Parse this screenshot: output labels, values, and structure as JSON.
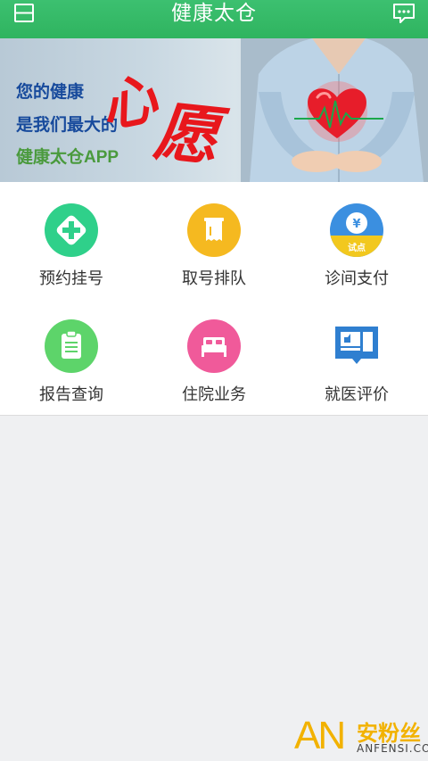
{
  "header": {
    "title": "健康太仓",
    "left_icon": "menu-icon",
    "right_icon": "message-icon"
  },
  "banner": {
    "line1": "您的健康",
    "line2": "是我们最大的",
    "line3": "健康太仓APP",
    "wish_char1": "心",
    "wish_char2": "愿"
  },
  "menu": {
    "items": [
      {
        "label": "预约挂号",
        "icon": "register-plus-icon",
        "color": "#2fd08a"
      },
      {
        "label": "取号排队",
        "icon": "ticket-icon",
        "color": "#f5b920"
      },
      {
        "label": "诊间支付",
        "icon": "payment-icon",
        "color": "#3b8fe0",
        "badge": "试点"
      },
      {
        "label": "报告查询",
        "icon": "report-icon",
        "color": "#5dd46a"
      },
      {
        "label": "住院业务",
        "icon": "hospital-bed-icon",
        "color": "#f05a9a"
      },
      {
        "label": "就医评价",
        "icon": "evaluation-icon",
        "color": "#2f7fd0"
      }
    ]
  },
  "watermark": {
    "logo": "AN",
    "name": "安粉丝",
    "domain": "ANFENSI.COM"
  },
  "colors": {
    "header": "#34b865",
    "accent_red": "#e8171c",
    "accent_blue": "#174a9c",
    "accent_green": "#4a9a3d"
  }
}
